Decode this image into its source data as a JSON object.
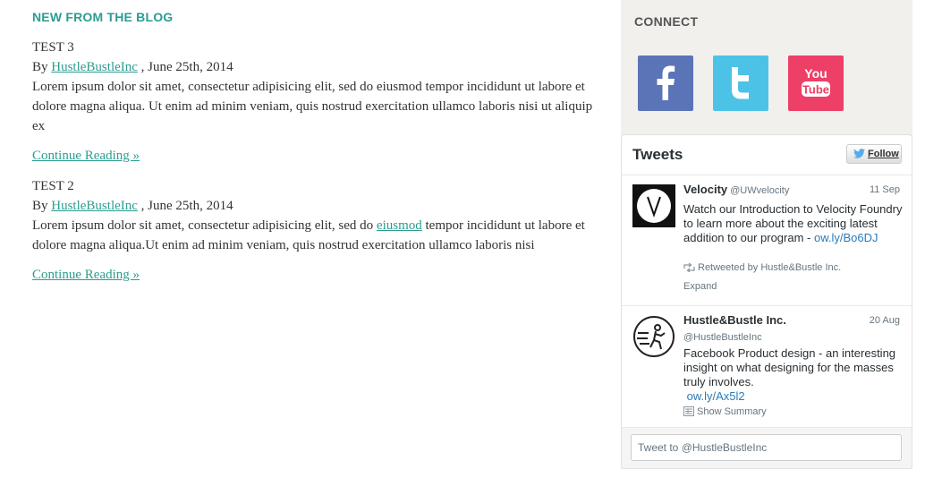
{
  "blog": {
    "heading": "NEW FROM THE BLOG",
    "posts": [
      {
        "title": "TEST 3",
        "by": "By ",
        "author": "HustleBustleInc",
        "date": " , June 25th, 2014",
        "body": "Lorem ipsum dolor sit amet, consectetur adipisicing elit, sed do eiusmod tempor incididunt ut labore et dolore magna aliqua. Ut enim ad minim veniam, quis nostrud exercitation ullamco laboris nisi ut aliquip ex",
        "continue": "Continue Reading »"
      },
      {
        "title": "TEST 2",
        "by": "By ",
        "author": "HustleBustleInc",
        "date": " , June 25th, 2014",
        "body_before": "Lorem ipsum dolor sit amet, consectetur adipisicing elit, sed do ",
        "body_link": "eiusmod",
        "body_after": " tempor incididunt ut labore et dolore magna aliqua.Ut enim ad minim veniam, quis nostrud exercitation ullamco laboris nisi",
        "continue": "Continue Reading »"
      }
    ]
  },
  "sidebar": {
    "connect_title": "CONNECT",
    "social": [
      {
        "name": "facebook",
        "icon": "facebook-icon",
        "color": "#5b74b8"
      },
      {
        "name": "twitter",
        "icon": "twitter-icon",
        "color": "#4cc3e6"
      },
      {
        "name": "youtube",
        "icon": "youtube-icon",
        "color": "#ee3f67"
      }
    ]
  },
  "widget": {
    "title": "Tweets",
    "follow_label": "Follow",
    "tweets": [
      {
        "name": "Velocity",
        "handle": "@UWvelocity",
        "date": "11 Sep",
        "text": "Watch our Introduction to Velocity Foundry to learn more about the exciting latest addition to our program - ",
        "link": "ow.ly/Bo6DJ",
        "retweet": "Retweeted by Hustle&Bustle Inc.",
        "action": "Expand"
      },
      {
        "name": "Hustle&Bustle Inc.",
        "handle": "@HustleBustleInc",
        "date": "20 Aug",
        "text": "Facebook Product design - an interesting insight on what designing for the masses truly involves.",
        "link": "ow.ly/Ax5l2",
        "action": "Show Summary"
      }
    ],
    "compose_placeholder": "Tweet to @HustleBustleInc"
  },
  "colors": {
    "accent": "#2a9d8f",
    "tweet_link": "#2b7bb9",
    "sidebar_bg": "#f1f0ed"
  }
}
